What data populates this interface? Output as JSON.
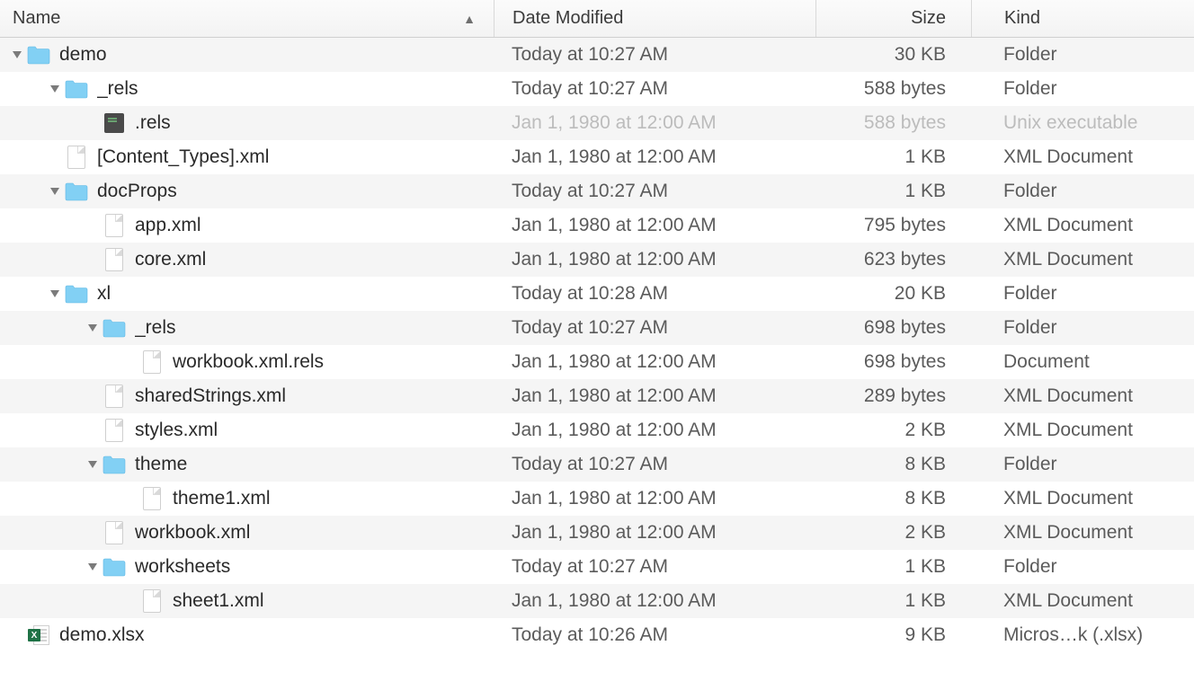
{
  "columns": {
    "name": "Name",
    "date": "Date Modified",
    "size": "Size",
    "kind": "Kind"
  },
  "rows": [
    {
      "name": "demo",
      "date": "Today at 10:27 AM",
      "size": "30 KB",
      "kind": "Folder",
      "indent": 0,
      "folder": true,
      "expanded": true
    },
    {
      "name": "_rels",
      "date": "Today at 10:27 AM",
      "size": "588 bytes",
      "kind": "Folder",
      "indent": 1,
      "folder": true,
      "expanded": true
    },
    {
      "name": ".rels",
      "date": "Jan 1, 1980 at 12:00 AM",
      "size": "588 bytes",
      "kind": "Unix executable",
      "indent": 2,
      "folder": false,
      "icon": "exec",
      "dim": true
    },
    {
      "name": "[Content_Types].xml",
      "date": "Jan 1, 1980 at 12:00 AM",
      "size": "1 KB",
      "kind": "XML Document",
      "indent": 1,
      "folder": false,
      "icon": "file"
    },
    {
      "name": "docProps",
      "date": "Today at 10:27 AM",
      "size": "1 KB",
      "kind": "Folder",
      "indent": 1,
      "folder": true,
      "expanded": true
    },
    {
      "name": "app.xml",
      "date": "Jan 1, 1980 at 12:00 AM",
      "size": "795 bytes",
      "kind": "XML Document",
      "indent": 2,
      "folder": false,
      "icon": "file"
    },
    {
      "name": "core.xml",
      "date": "Jan 1, 1980 at 12:00 AM",
      "size": "623 bytes",
      "kind": "XML Document",
      "indent": 2,
      "folder": false,
      "icon": "file"
    },
    {
      "name": "xl",
      "date": "Today at 10:28 AM",
      "size": "20 KB",
      "kind": "Folder",
      "indent": 1,
      "folder": true,
      "expanded": true
    },
    {
      "name": "_rels",
      "date": "Today at 10:27 AM",
      "size": "698 bytes",
      "kind": "Folder",
      "indent": 2,
      "folder": true,
      "expanded": true
    },
    {
      "name": "workbook.xml.rels",
      "date": "Jan 1, 1980 at 12:00 AM",
      "size": "698 bytes",
      "kind": "Document",
      "indent": 3,
      "folder": false,
      "icon": "file"
    },
    {
      "name": "sharedStrings.xml",
      "date": "Jan 1, 1980 at 12:00 AM",
      "size": "289 bytes",
      "kind": "XML Document",
      "indent": 2,
      "folder": false,
      "icon": "file"
    },
    {
      "name": "styles.xml",
      "date": "Jan 1, 1980 at 12:00 AM",
      "size": "2 KB",
      "kind": "XML Document",
      "indent": 2,
      "folder": false,
      "icon": "file"
    },
    {
      "name": "theme",
      "date": "Today at 10:27 AM",
      "size": "8 KB",
      "kind": "Folder",
      "indent": 2,
      "folder": true,
      "expanded": true
    },
    {
      "name": "theme1.xml",
      "date": "Jan 1, 1980 at 12:00 AM",
      "size": "8 KB",
      "kind": "XML Document",
      "indent": 3,
      "folder": false,
      "icon": "file"
    },
    {
      "name": "workbook.xml",
      "date": "Jan 1, 1980 at 12:00 AM",
      "size": "2 KB",
      "kind": "XML Document",
      "indent": 2,
      "folder": false,
      "icon": "file"
    },
    {
      "name": "worksheets",
      "date": "Today at 10:27 AM",
      "size": "1 KB",
      "kind": "Folder",
      "indent": 2,
      "folder": true,
      "expanded": true
    },
    {
      "name": "sheet1.xml",
      "date": "Jan 1, 1980 at 12:00 AM",
      "size": "1 KB",
      "kind": "XML Document",
      "indent": 3,
      "folder": false,
      "icon": "file"
    },
    {
      "name": "demo.xlsx",
      "date": "Today at 10:26 AM",
      "size": "9 KB",
      "kind": "Micros…k (.xlsx)",
      "indent": 0,
      "folder": false,
      "icon": "xlsx"
    }
  ]
}
